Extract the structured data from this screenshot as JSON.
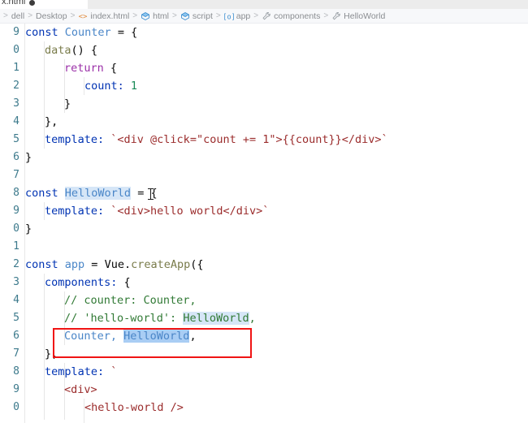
{
  "window": {
    "tab": {
      "label": "x.html",
      "dirty_dot": true,
      "dot_name": "unsaved-indicator"
    }
  },
  "breadcrumb": {
    "items": [
      {
        "label": "dell",
        "icon": ""
      },
      {
        "label": "Desktop",
        "icon": ""
      },
      {
        "label": "index.html",
        "icon": "html-tag-icon"
      },
      {
        "label": "html",
        "icon": "cube-icon"
      },
      {
        "label": "script",
        "icon": "cube-icon"
      },
      {
        "label": "app",
        "icon": "object-icon"
      },
      {
        "label": "components",
        "icon": "wrench-icon"
      },
      {
        "label": "HelloWorld",
        "icon": "wrench-icon"
      }
    ],
    "separator": ">"
  },
  "editor": {
    "line_numbers": [
      "9",
      "0",
      "1",
      "2",
      "3",
      "4",
      "5",
      "6",
      "7",
      "8",
      "9",
      "0",
      "1",
      "2",
      "3",
      "4",
      "5",
      "6",
      "7",
      "8",
      "9",
      "0"
    ],
    "lines": [
      {
        "n": "9",
        "text": "const Counter = {"
      },
      {
        "n": "0",
        "text": "  data() {"
      },
      {
        "n": "1",
        "text": "    return {"
      },
      {
        "n": "2",
        "text": "      count: 1"
      },
      {
        "n": "3",
        "text": "    }"
      },
      {
        "n": "4",
        "text": "  },"
      },
      {
        "n": "5",
        "text": "  template: `<div @click=\"count += 1\">{{count}}</div>`"
      },
      {
        "n": "6",
        "text": "}"
      },
      {
        "n": "7",
        "text": ""
      },
      {
        "n": "8",
        "text": "const HelloWorld = {"
      },
      {
        "n": "9",
        "text": "  template: `<div>hello world</div>`"
      },
      {
        "n": "0",
        "text": "}"
      },
      {
        "n": "1",
        "text": ""
      },
      {
        "n": "2",
        "text": "const app = Vue.createApp({"
      },
      {
        "n": "3",
        "text": "  components: {"
      },
      {
        "n": "4",
        "text": "    // counter: Counter,"
      },
      {
        "n": "5",
        "text": "    // 'hello-world': HelloWorld,"
      },
      {
        "n": "6",
        "text": "    Counter, HelloWorld,"
      },
      {
        "n": "7",
        "text": "  },"
      },
      {
        "n": "8",
        "text": "  template: `"
      },
      {
        "n": "9",
        "text": "    <div>"
      },
      {
        "n": "0",
        "text": "      <hello-world />"
      }
    ],
    "tokens": {
      "const": "const",
      "counter_name": "Counter",
      "eq_brace": " = {",
      "data_fn": "data",
      "parens_brace": "() {",
      "return": "return",
      "brace_open": " {",
      "count_key": "count: ",
      "count_val": "1",
      "brace_close": "}",
      "brace_close_comma": "},",
      "template_key": "template: ",
      "counter_template": "`<div @click=\"count += 1\">{{count}}</div>`",
      "helloworld_name": "HelloWorld",
      "helloworld_template": "`<div>hello world</div>`",
      "app_name": "app",
      "vue": "Vue",
      "dot": ".",
      "createapp": "createApp",
      "paren_brace": "({",
      "components_key": "components: ",
      "comment_counter": "// counter: Counter,",
      "comment_hello_a": "// 'hello-world': ",
      "comment_hello_b": "HelloWorld",
      "comment_hello_c": ",",
      "counter_ref": "Counter, ",
      "helloworld_ref": "HelloWorld",
      "trailing_comma": ",",
      "backtick": "`",
      "div_open": "<div>",
      "hello_world_tag": "<hello-world />"
    },
    "colors": {
      "keyword": "#0033b3",
      "class_name": "#4a86c8",
      "string": "#9b2c2c",
      "comment": "#317a35",
      "number": "#1a8a57",
      "function": "#7a7c4b",
      "return_kw": "#9b30a8",
      "line_number": "#3d7a8c",
      "selection_bg": "#a9cdf4",
      "occurrence_bg": "#d6e6f7",
      "annotation_red": "#f01414",
      "background": "#ffffff"
    }
  },
  "annotation": {
    "name": "red-highlight-box",
    "target_line": "    Counter, HelloWorld,"
  }
}
